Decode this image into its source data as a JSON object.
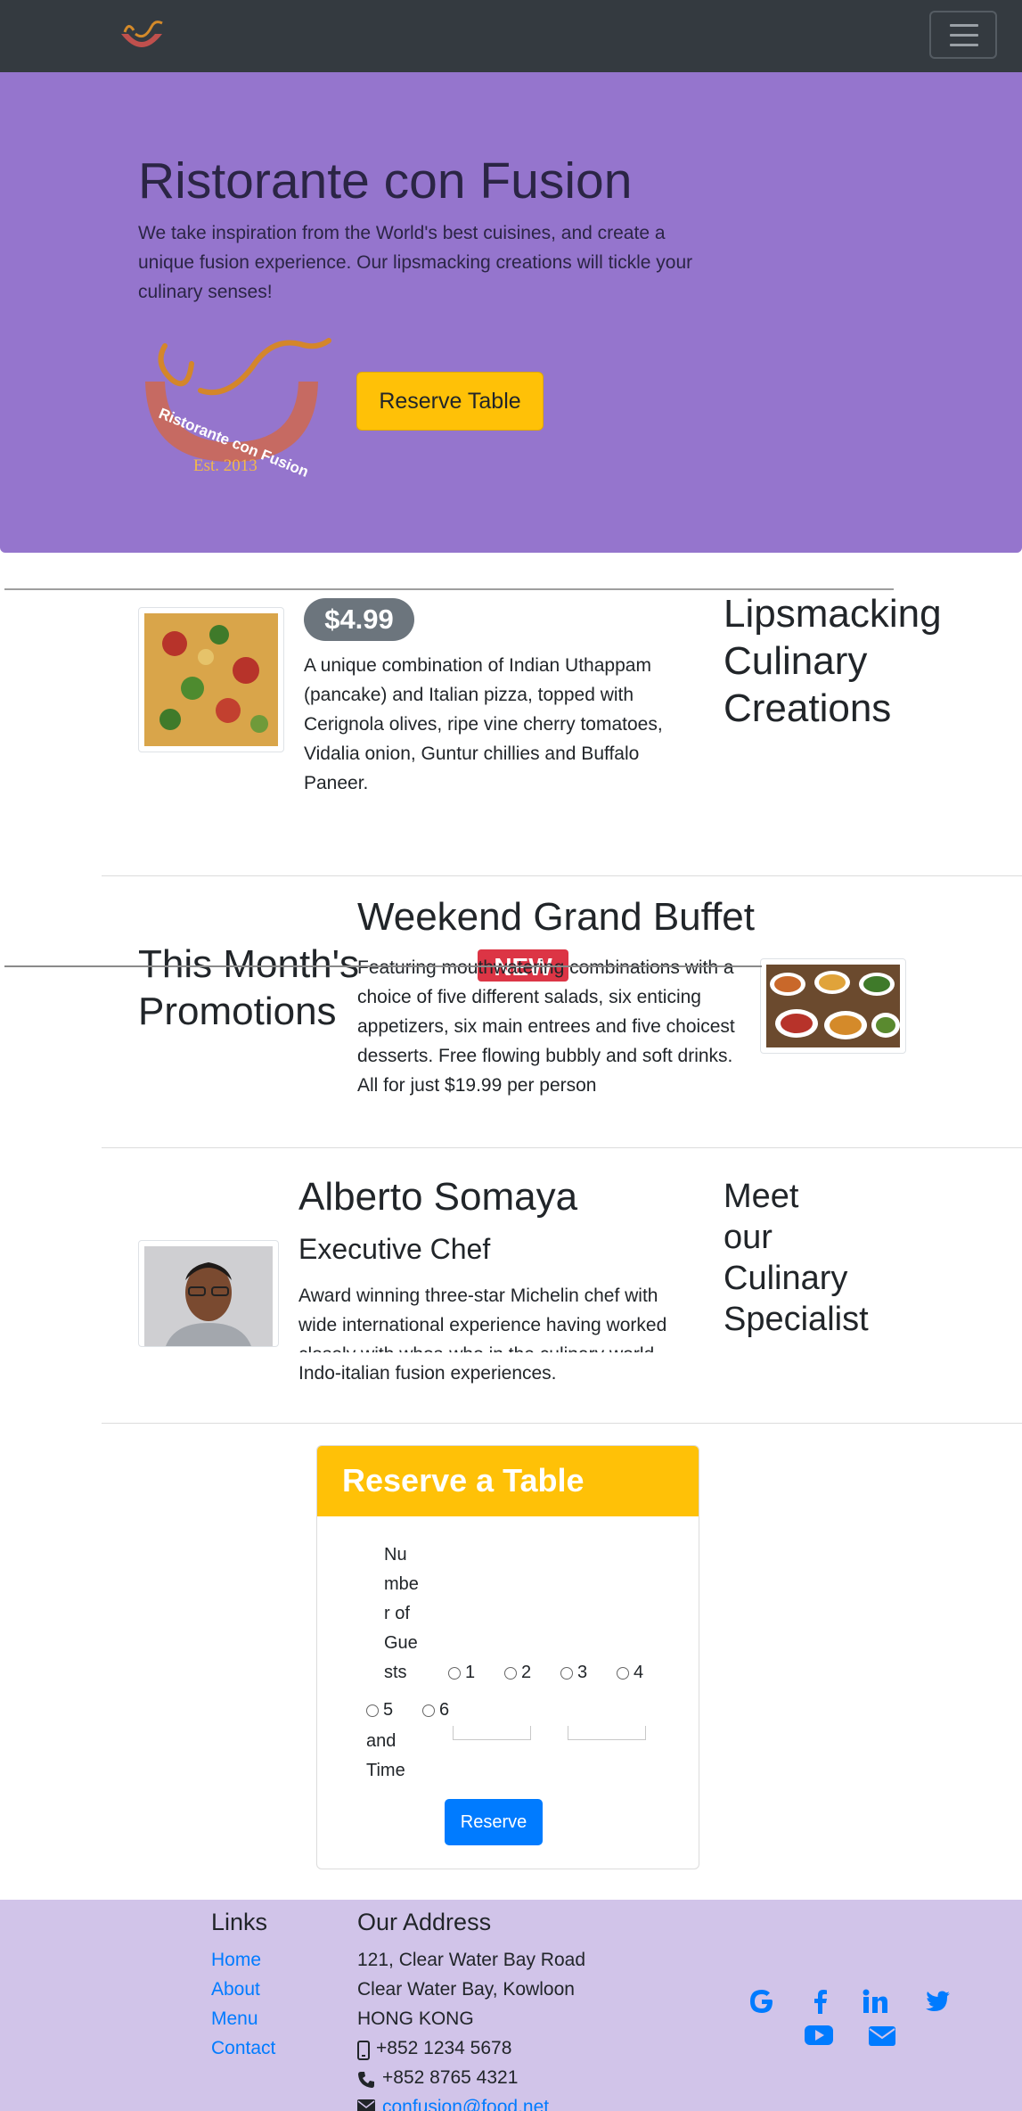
{
  "navbar": {
    "logo_icon": "restaurant-logo",
    "toggler_icon": "hamburger-menu"
  },
  "jumbotron": {
    "title": "Ristorante con Fusion",
    "text": "We take inspiration from the World's best cuisines, and create a unique fusion experience. Our lipsmacking creations will tickle your culinary senses!",
    "logo_text_1": "Ristorante con Fusion",
    "logo_text_2": "Est. 2013",
    "reserve_button": "Reserve Table",
    "background_color": "#9575cd"
  },
  "dish": {
    "price": "$4.99",
    "description": "A unique combination of Indian Uthappam (pancake) and Italian pizza, topped with Cerignola olives, ripe vine cherry tomatoes, Vidalia onion, Guntur chillies and Buffalo Paneer.",
    "heading_lines": [
      "Lipsmacking",
      "Culinary",
      "Creations"
    ]
  },
  "promotion": {
    "title": "Weekend Grand Buffet",
    "badge": "NEW",
    "description": "Featuring mouthwatering combinations with a choice of five different salads, six enticing appetizers, six main entrees and five choicest desserts. Free flowing bubbly and soft drinks. All for just $19.99 per person",
    "heading_lines": [
      "This Month's",
      "Promotions"
    ]
  },
  "leader": {
    "name": "Alberto Somaya",
    "role": "Executive Chef",
    "description": "Award winning three-star Michelin chef with wide international experience having worked closely with whos-who in the culinary world, he specializes in creating mouthwatering Indo-italian fusion experiences.",
    "heading_lines": [
      "Meet",
      "our",
      "Culinary",
      "Specialist"
    ]
  },
  "reservation": {
    "title": "Reserve a Table",
    "guests_label_lines": [
      "Nu",
      "mbe",
      "r of",
      "Gue",
      "sts"
    ],
    "options": [
      "1",
      "2",
      "3",
      "4",
      "5",
      "6"
    ],
    "date_label_lines": [
      "and",
      "Time"
    ],
    "submit": "Reserve",
    "header_color": "#ffc107"
  },
  "footer": {
    "links_heading": "Links",
    "links": [
      "Home",
      "About",
      "Menu",
      "Contact"
    ],
    "address_heading": "Our Address",
    "address_lines": [
      "121, Clear Water Bay Road",
      "Clear Water Bay, Kowloon",
      "HONG KONG"
    ],
    "phone": "+852 1234 5678",
    "fax": "+852 8765 4321",
    "email": "confusion@food.net",
    "social_icons": [
      "google-icon",
      "facebook-icon",
      "linkedin-icon",
      "twitter-icon",
      "youtube-icon",
      "mail-icon"
    ],
    "background_color": "#d1c4e9"
  }
}
